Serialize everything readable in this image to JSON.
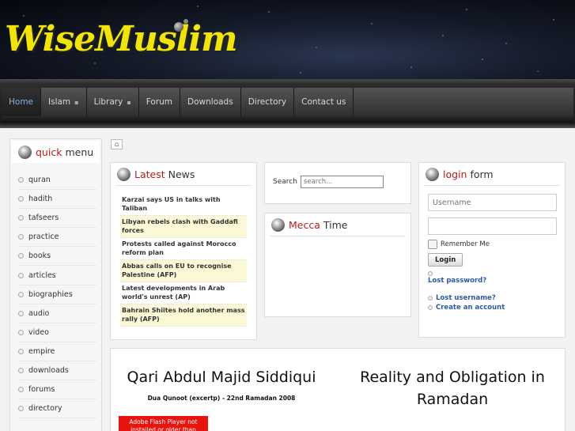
{
  "header": {
    "logo": "WiseMuslim"
  },
  "nav": {
    "items": [
      {
        "label": "Home",
        "active": true,
        "dropdown": false
      },
      {
        "label": "Islam",
        "active": false,
        "dropdown": true
      },
      {
        "label": "Library",
        "active": false,
        "dropdown": true
      },
      {
        "label": "Forum",
        "active": false,
        "dropdown": false
      },
      {
        "label": "Downloads",
        "active": false,
        "dropdown": false
      },
      {
        "label": "Directory",
        "active": false,
        "dropdown": false
      },
      {
        "label": "Contact us",
        "active": false,
        "dropdown": false
      }
    ]
  },
  "quick_menu": {
    "title_accent": "quick",
    "title_rest": "menu",
    "items": [
      "quran",
      "hadith",
      "tafseers",
      "practice",
      "books",
      "articles",
      "biographies",
      "audio",
      "video",
      "empire",
      "downloads",
      "forums",
      "directory"
    ]
  },
  "news": {
    "title_accent": "Latest",
    "title_rest": "News",
    "items": [
      {
        "text": "Karzai says US in talks with Taliban",
        "highlight": false
      },
      {
        "text": "Libyan rebels clash with Gaddafi forces",
        "highlight": true
      },
      {
        "text": "Protests called against Morocco reform plan",
        "highlight": false
      },
      {
        "text": "Abbas calls on EU to recognise Palestine (AFP)",
        "highlight": true
      },
      {
        "text": "Latest developments in Arab world's unrest (AP)",
        "highlight": false
      },
      {
        "text": "Bahrain Shiites hold another mass rally (AFP)",
        "highlight": true
      }
    ]
  },
  "search": {
    "label": "Search",
    "placeholder": "search..."
  },
  "mecca": {
    "title_accent": "Mecca",
    "title_rest": "Time"
  },
  "login": {
    "title_accent": "login",
    "title_rest": "form",
    "username_placeholder": "Username",
    "password_placeholder": "",
    "remember_label": "Remember Me",
    "button_label": "Login",
    "lost_password": "Lost password?",
    "lost_username": "Lost username?",
    "create_account": "Create an account"
  },
  "featured": {
    "left_title": "Qari Abdul Majid Siddiqui",
    "left_subtitle": "Dua Qunoot (excertp) - 22nd Ramadan 2008",
    "flash_notice": "Adobe Flash Player not installed or older than",
    "right_title": "Reality and Obligation in Ramadan"
  },
  "colors": {
    "accent_red": "#b81c1c",
    "logo_yellow": "#f2e600",
    "nav_active": "#7fb0e8",
    "link_blue": "#2a5aa8",
    "highlight": "#fbf8d6"
  },
  "icons": {
    "home": "home-icon",
    "module": "moon-icon",
    "bullet": "bullet-icon"
  }
}
